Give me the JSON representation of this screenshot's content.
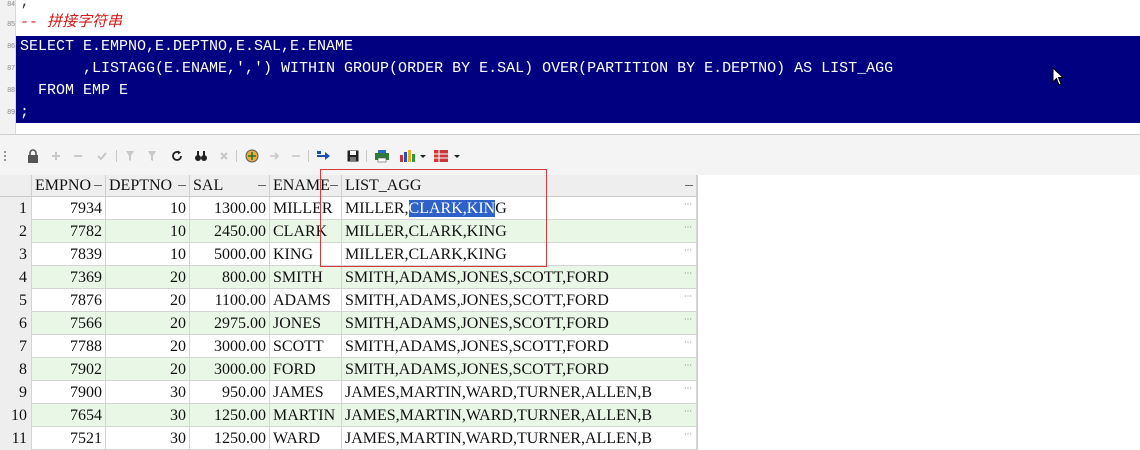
{
  "editor": {
    "line_numbers": [
      "84",
      "85",
      "86",
      "87",
      "88",
      "89"
    ],
    "line1": ";",
    "comment": "-- 拼接字符串",
    "sql_line1": "SELECT E.EMPNO,E.DEPTNO,E.SAL,E.ENAME",
    "sql_line2": "       ,LISTAGG(E.ENAME,',') WITHIN GROUP(ORDER BY E.SAL) OVER(PARTITION BY E.DEPTNO) AS LIST_AGG",
    "sql_line3": "  FROM EMP E",
    "sql_line4": ";"
  },
  "toolbar": {
    "icons": [
      "lock-icon",
      "add-row-icon",
      "delete-row-icon",
      "post-icon",
      "filter-icon",
      "clear-filter-icon",
      "refresh-icon",
      "find-icon",
      "clear-icon",
      "query-icon",
      "next-icon",
      "previous-icon",
      "export-icon",
      "save-icon",
      "print-icon",
      "chart-icon",
      "grid-options-icon"
    ]
  },
  "grid": {
    "columns": [
      "EMPNO",
      "DEPTNO",
      "SAL",
      "ENAME",
      "LIST_AGG"
    ],
    "rows": [
      {
        "n": "1",
        "empno": "7934",
        "deptno": "10",
        "sal": "1300.00",
        "ename": "MILLER",
        "agg_a": "MILLER,",
        "agg_b": "CLARK,KIN",
        "agg_c": "G"
      },
      {
        "n": "2",
        "empno": "7782",
        "deptno": "10",
        "sal": "2450.00",
        "ename": "CLARK",
        "agg_a": "MILLER,CLARK,KING",
        "agg_b": "",
        "agg_c": ""
      },
      {
        "n": "3",
        "empno": "7839",
        "deptno": "10",
        "sal": "5000.00",
        "ename": "KING",
        "agg_a": "MILLER,CLARK,KING",
        "agg_b": "",
        "agg_c": ""
      },
      {
        "n": "4",
        "empno": "7369",
        "deptno": "20",
        "sal": "800.00",
        "ename": "SMITH",
        "agg_a": "SMITH,ADAMS,JONES,SCOTT,FORD",
        "agg_b": "",
        "agg_c": ""
      },
      {
        "n": "5",
        "empno": "7876",
        "deptno": "20",
        "sal": "1100.00",
        "ename": "ADAMS",
        "agg_a": "SMITH,ADAMS,JONES,SCOTT,FORD",
        "agg_b": "",
        "agg_c": ""
      },
      {
        "n": "6",
        "empno": "7566",
        "deptno": "20",
        "sal": "2975.00",
        "ename": "JONES",
        "agg_a": "SMITH,ADAMS,JONES,SCOTT,FORD",
        "agg_b": "",
        "agg_c": ""
      },
      {
        "n": "7",
        "empno": "7788",
        "deptno": "20",
        "sal": "3000.00",
        "ename": "SCOTT",
        "agg_a": "SMITH,ADAMS,JONES,SCOTT,FORD",
        "agg_b": "",
        "agg_c": ""
      },
      {
        "n": "8",
        "empno": "7902",
        "deptno": "20",
        "sal": "3000.00",
        "ename": "FORD",
        "agg_a": "SMITH,ADAMS,JONES,SCOTT,FORD",
        "agg_b": "",
        "agg_c": ""
      },
      {
        "n": "9",
        "empno": "7900",
        "deptno": "30",
        "sal": "950.00",
        "ename": "JAMES",
        "agg_a": "JAMES,MARTIN,WARD,TURNER,ALLEN,B",
        "agg_b": "",
        "agg_c": ""
      },
      {
        "n": "10",
        "empno": "7654",
        "deptno": "30",
        "sal": "1250.00",
        "ename": "MARTIN",
        "agg_a": "JAMES,MARTIN,WARD,TURNER,ALLEN,B",
        "agg_b": "",
        "agg_c": ""
      },
      {
        "n": "11",
        "empno": "7521",
        "deptno": "30",
        "sal": "1250.00",
        "ename": "WARD",
        "agg_a": "JAMES,MARTIN,WARD,TURNER,ALLEN,B",
        "agg_b": "",
        "agg_c": ""
      }
    ]
  },
  "colors": {
    "selection": "#000080",
    "comment": "#d21a1a",
    "row_alt": "#e9f7e6",
    "highlight_box": "#d63a3a",
    "cell_selection": "#2f62c8"
  }
}
